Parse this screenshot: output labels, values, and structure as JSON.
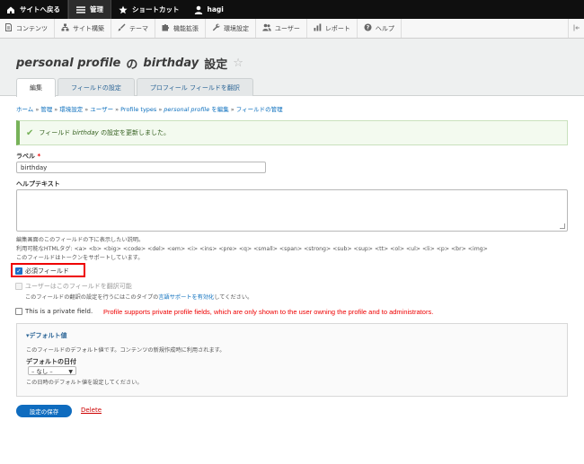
{
  "toolbar": {
    "back_label": "サイトへ戻る",
    "manage_label": "管理",
    "shortcuts_label": "ショートカット",
    "user_label": "hagi"
  },
  "tray": {
    "items": [
      "コンテンツ",
      "サイト構築",
      "テーマ",
      "機能拡張",
      "環境設定",
      "ユーザー",
      "レポート",
      "ヘルプ"
    ]
  },
  "header": {
    "title_italic_1": "personal profile",
    "title_of": "の",
    "title_italic_2": "birthday",
    "title_suffix": "設定",
    "star": "☆"
  },
  "tabs": [
    "編集",
    "フィールドの設定",
    "プロフィール フィールドを翻訳"
  ],
  "breadcrumb": {
    "items": [
      "ホーム",
      "管理",
      "環境設定",
      "ユーザー",
      "Profile types"
    ],
    "edit_italic": "personal profile",
    "edit_suffix": "を編集",
    "last": "フィールドの管理",
    "sep": "»"
  },
  "message": {
    "prefix": "フィールド",
    "field": "birthday",
    "suffix": "の設定を更新しました。"
  },
  "form": {
    "label_title": "ラベル",
    "required_mark": "*",
    "label_value": "birthday",
    "help_title": "ヘルプテキスト",
    "help_desc_1": "編集画面のこのフィールドの下に表示したい説明。",
    "help_desc_2": "利用可能なHTMLタグ: <a> <b> <big> <code> <del> <em> <i> <ins> <pre> <q> <small> <span> <strong> <sub> <sup> <tt> <ol> <ul> <li> <p> <br> <img>",
    "help_desc_3": "このフィールドはトークンをサポートしています。",
    "required_label": "必須フィールド",
    "translatable_label": "ユーザーはこのフィールドを翻訳可能",
    "translatable_desc_prefix": "このフィールドの翻訳の設定を行うにはこのタイプの",
    "translatable_desc_link": "言語サポートを有効化",
    "translatable_desc_suffix": "してください。",
    "private_label": "This is a private field.",
    "private_note": "Profile supports private profile fields, which are only shown to the user owning the profile and to administrators."
  },
  "default_value": {
    "legend": "▾デフォルト値",
    "description": "このフィールドのデフォルト値です。コンテンツの新規作成時に利用されます。",
    "date_label": "デフォルトの日付",
    "select_value": "– なし –",
    "date_desc": "この日時のデフォルト値を設定してください。"
  },
  "actions": {
    "save_label": "設定の保存",
    "delete_label": "Delete"
  },
  "colors": {
    "primary": "#0f6cbf",
    "link": "#0a6ebd",
    "highlight": "#ee0000",
    "success": "#77b259"
  }
}
